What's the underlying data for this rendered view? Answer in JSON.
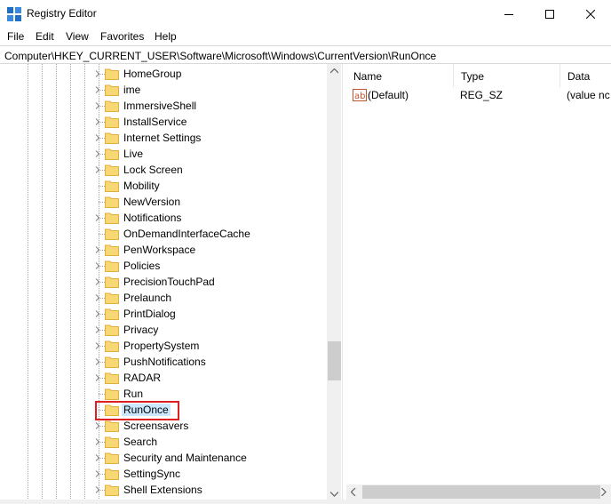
{
  "window": {
    "title": "Registry Editor",
    "controls": [
      "minimize",
      "maximize",
      "close"
    ]
  },
  "menu": [
    "File",
    "Edit",
    "View",
    "Favorites",
    "Help"
  ],
  "address": "Computer\\HKEY_CURRENT_USER\\Software\\Microsoft\\Windows\\CurrentVersion\\RunOnce",
  "tree": {
    "items": [
      {
        "label": "HomeGroup",
        "expandable": true
      },
      {
        "label": "ime",
        "expandable": true
      },
      {
        "label": "ImmersiveShell",
        "expandable": true
      },
      {
        "label": "InstallService",
        "expandable": true
      },
      {
        "label": "Internet Settings",
        "expandable": true
      },
      {
        "label": "Live",
        "expandable": true
      },
      {
        "label": "Lock Screen",
        "expandable": true
      },
      {
        "label": "Mobility",
        "expandable": false
      },
      {
        "label": "NewVersion",
        "expandable": false
      },
      {
        "label": "Notifications",
        "expandable": true
      },
      {
        "label": "OnDemandInterfaceCache",
        "expandable": false
      },
      {
        "label": "PenWorkspace",
        "expandable": true
      },
      {
        "label": "Policies",
        "expandable": true
      },
      {
        "label": "PrecisionTouchPad",
        "expandable": true
      },
      {
        "label": "Prelaunch",
        "expandable": true
      },
      {
        "label": "PrintDialog",
        "expandable": true
      },
      {
        "label": "Privacy",
        "expandable": true
      },
      {
        "label": "PropertySystem",
        "expandable": true
      },
      {
        "label": "PushNotifications",
        "expandable": true
      },
      {
        "label": "RADAR",
        "expandable": true
      },
      {
        "label": "Run",
        "expandable": false
      },
      {
        "label": "RunOnce",
        "expandable": false,
        "selected": true
      },
      {
        "label": "Screensavers",
        "expandable": true
      },
      {
        "label": "Search",
        "expandable": true
      },
      {
        "label": "Security and Maintenance",
        "expandable": true
      },
      {
        "label": "SettingSync",
        "expandable": true
      },
      {
        "label": "Shell Extensions",
        "expandable": true
      }
    ]
  },
  "list": {
    "columns": [
      "Name",
      "Type",
      "Data"
    ],
    "rows": [
      {
        "name": "(Default)",
        "type": "REG_SZ",
        "data": "(value nc"
      }
    ]
  },
  "colors": {
    "selection": "#cce8ff",
    "highlight_border": "#e02020",
    "folder": "#f8d775",
    "folder_dark": "#e0b03c"
  },
  "icons": {
    "app": "registry-editor-icon",
    "folder": "folder-icon",
    "expander": "chevron-right-icon",
    "value": "string-value-icon"
  }
}
